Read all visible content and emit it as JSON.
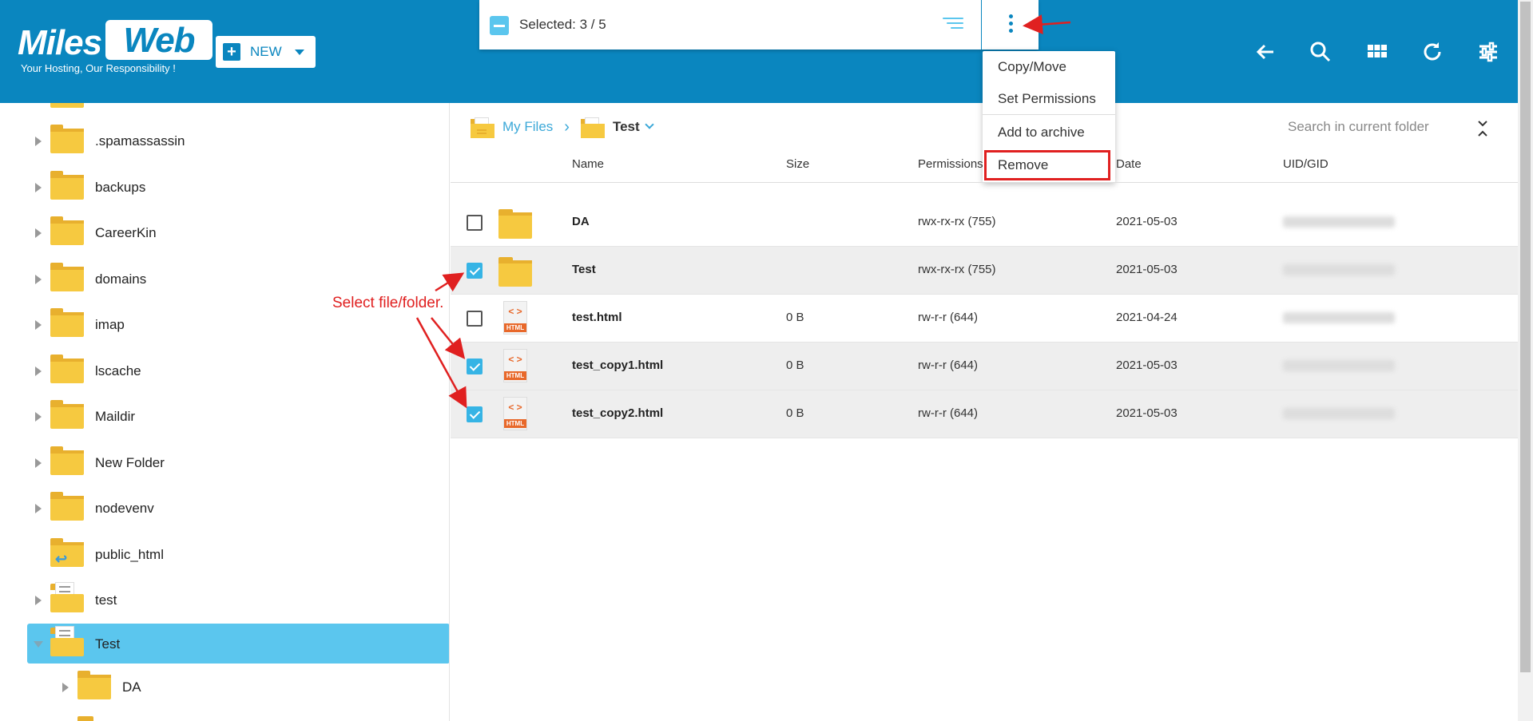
{
  "brand": {
    "name_part1": "Miles",
    "name_part2": "Web",
    "tagline": "Your Hosting, Our Responsibility !"
  },
  "toolbar": {
    "new_label": "NEW",
    "selection_text": "Selected: 3 / 5",
    "icons": [
      "back-arrow-icon",
      "search-icon",
      "grid-view-icon",
      "refresh-icon",
      "settings-sliders-icon"
    ]
  },
  "context_menu": {
    "items": [
      "Copy/Move",
      "Set Permissions",
      "Add to archive",
      "Remove"
    ],
    "highlighted": "Remove"
  },
  "sidebar": {
    "items": [
      {
        "label": ".spamassassin"
      },
      {
        "label": "backups"
      },
      {
        "label": "CareerKin"
      },
      {
        "label": "domains"
      },
      {
        "label": "imap"
      },
      {
        "label": "lscache"
      },
      {
        "label": "Maildir"
      },
      {
        "label": "New Folder"
      },
      {
        "label": "nodevenv"
      },
      {
        "label": "public_html"
      },
      {
        "label": "test"
      },
      {
        "label": "Test"
      },
      {
        "label": "DA"
      }
    ],
    "selected": "Test"
  },
  "breadcrumb": {
    "root": "My Files",
    "current": "Test"
  },
  "search": {
    "placeholder": "Search in current folder"
  },
  "table": {
    "columns": [
      "Name",
      "Size",
      "Permissions",
      "Date",
      "UID/GID"
    ],
    "rows": [
      {
        "name": "DA",
        "size": "",
        "permissions": "rwx-rx-rx (755)",
        "date": "2021-05-03",
        "type": "folder",
        "checked": false
      },
      {
        "name": "Test",
        "size": "",
        "permissions": "rwx-rx-rx (755)",
        "date": "2021-05-03",
        "type": "folder",
        "checked": true
      },
      {
        "name": "test.html",
        "size": "0 B",
        "permissions": "rw-r-r (644)",
        "date": "2021-04-24",
        "type": "html",
        "checked": false
      },
      {
        "name": "test_copy1.html",
        "size": "0 B",
        "permissions": "rw-r-r (644)",
        "date": "2021-05-03",
        "type": "html",
        "checked": true
      },
      {
        "name": "test_copy2.html",
        "size": "0 B",
        "permissions": "rw-r-r (644)",
        "date": "2021-05-03",
        "type": "html",
        "checked": true
      }
    ],
    "html_icon_code": "< >",
    "html_icon_label": "HTML"
  },
  "annotation": {
    "text": "Select file/folder.",
    "color": "#e02020"
  },
  "colors": {
    "header": "#0a86bf",
    "accent": "#5bc6ee",
    "folder": "#f6c940",
    "highlight": "#e02020"
  }
}
